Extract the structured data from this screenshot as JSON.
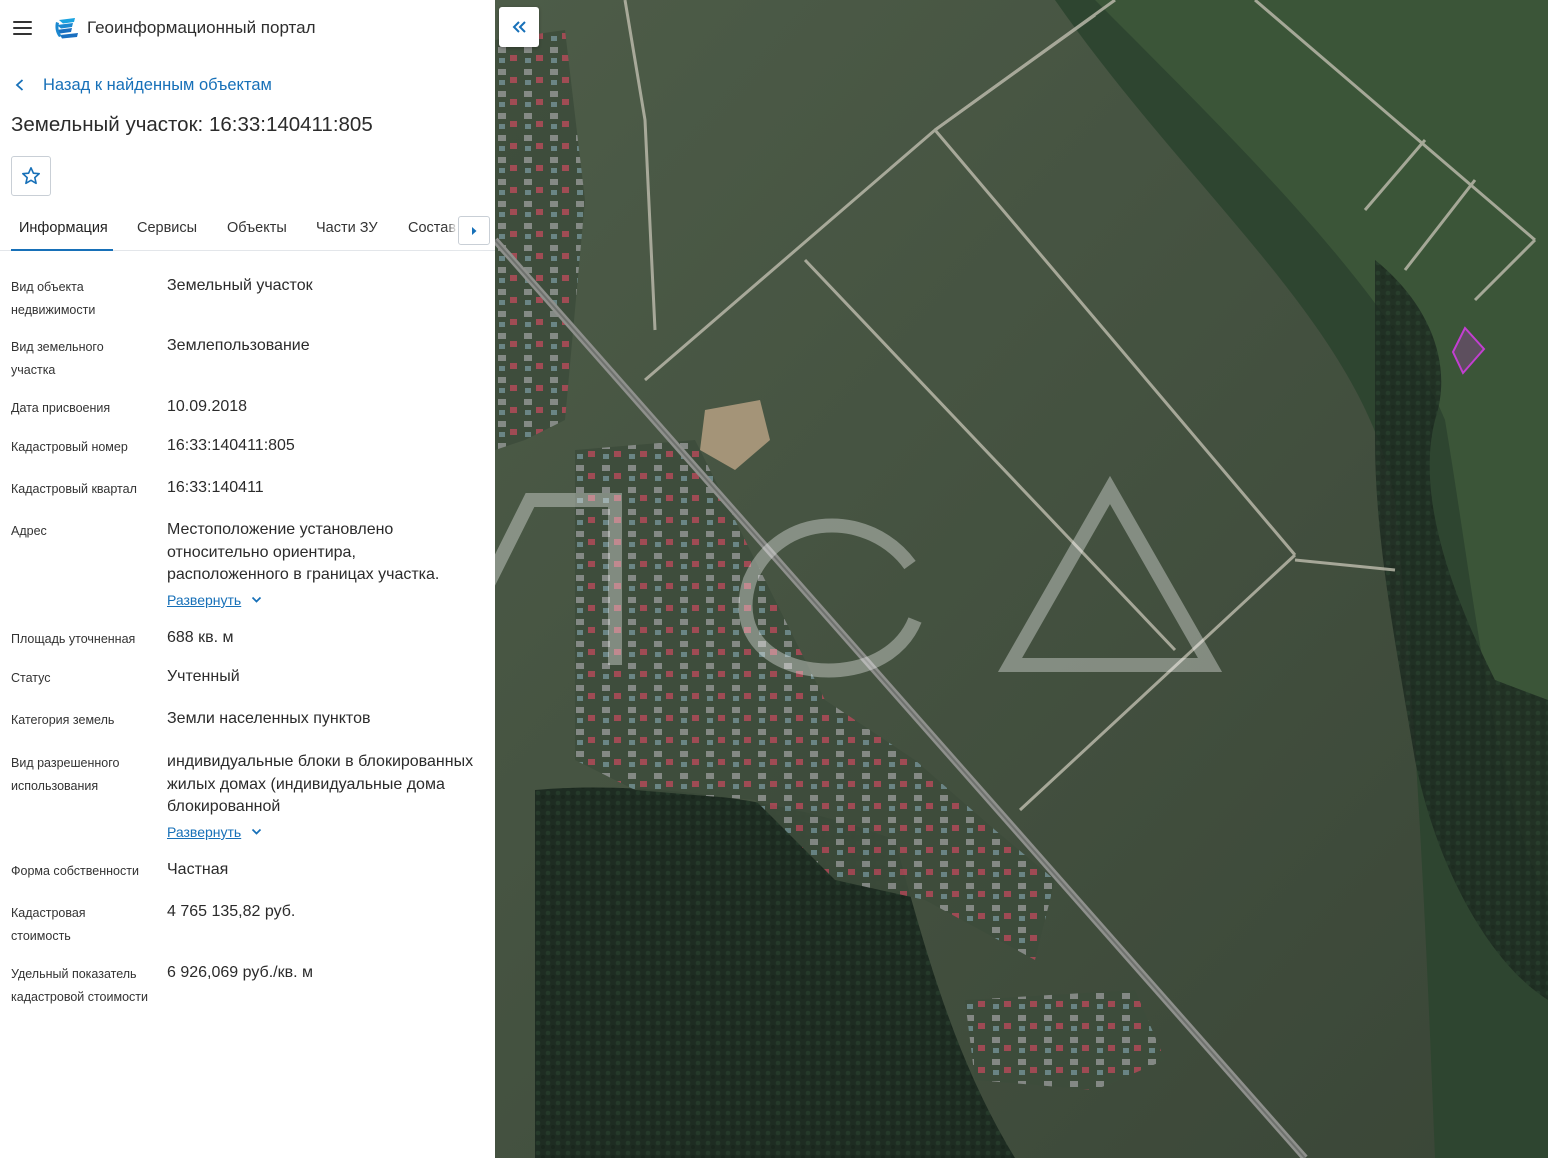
{
  "header": {
    "menu_icon": "hamburger-menu-icon",
    "logo_icon": "portal-logo-icon",
    "title": "Геоинформационный портал"
  },
  "back_link": {
    "label": "Назад к найденным объектам"
  },
  "object": {
    "title": "Земельный участок: 16:33:140411:805"
  },
  "favorite": {
    "icon": "star-icon"
  },
  "tabs": [
    {
      "label": "Информация",
      "active": true
    },
    {
      "label": "Сервисы"
    },
    {
      "label": "Объекты"
    },
    {
      "label": "Части ЗУ"
    },
    {
      "label": "Состав"
    }
  ],
  "fields": [
    {
      "label": "Вид объекта недвижимости",
      "value": "Земельный участок"
    },
    {
      "label": "Вид земельного участка",
      "value": "Землепользование"
    },
    {
      "label": "Дата присвоения",
      "value": "10.09.2018"
    },
    {
      "label": "Кадастровый номер",
      "value": "16:33:140411:805"
    },
    {
      "label": "Кадастровый квартал",
      "value": "16:33:140411"
    },
    {
      "label": "Адрес",
      "value": "Местоположение установлено относительно ориентира, расположенного в границах участка.",
      "expand": "Развернуть"
    },
    {
      "label": "Площадь уточненная",
      "value": "688 кв. м"
    },
    {
      "label": "Статус",
      "value": "Учтенный"
    },
    {
      "label": "Категория земель",
      "value": "Земли населенных пунктов"
    },
    {
      "label": "Вид разрешенного использования",
      "value": "индивидуальные блоки в блокированных жилых домах (индивидуальные дома блокированной",
      "expand": "Развернуть"
    },
    {
      "label": "Форма собственности",
      "value": "Частная"
    },
    {
      "label": "Кадастровая стоимость",
      "value": "4 765 135,82 руб."
    },
    {
      "label": "Удельный показатель кадастровой стоимости",
      "value": "6 926,069 руб./кв. м"
    }
  ],
  "map": {
    "collapse_icon": "double-chevron-left-icon",
    "watermark_text": "MИСА",
    "parcel_color": "#c23fd0"
  },
  "colors": {
    "accent": "#1770b8",
    "text": "#2b2b2b"
  }
}
